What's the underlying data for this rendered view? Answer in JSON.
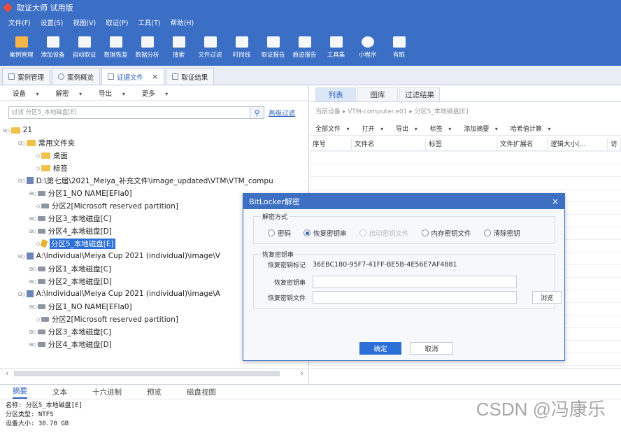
{
  "app": {
    "title": "取证大师 试用版"
  },
  "menu": [
    "文件(F)",
    "设置(S)",
    "视图(V)",
    "取证(P)",
    "工具(T)",
    "帮助(H)"
  ],
  "toolbar": [
    {
      "label": "案例管理",
      "icon": "case-manage-icon"
    },
    {
      "label": "添加设备",
      "icon": "add-device-icon"
    },
    {
      "label": "自动取证",
      "icon": "auto-forensics-icon"
    },
    {
      "label": "数据恢复",
      "icon": "data-recovery-icon"
    },
    {
      "label": "数据分析",
      "icon": "data-analysis-icon"
    },
    {
      "label": "搜索",
      "icon": "search-icon"
    },
    {
      "label": "文件过滤",
      "icon": "file-filter-icon"
    },
    {
      "label": "时间线",
      "icon": "timeline-icon"
    },
    {
      "label": "取证报告",
      "icon": "report-icon"
    },
    {
      "label": "痕迹报告",
      "icon": "trace-report-icon"
    },
    {
      "label": "工具集",
      "icon": "toolset-icon"
    },
    {
      "label": "小程序",
      "icon": "mini-program-icon"
    },
    {
      "label": "有眼",
      "icon": "assistant-icon"
    }
  ],
  "doctabs": [
    {
      "label": "案例管理",
      "active": false
    },
    {
      "label": "案例概览",
      "active": false
    },
    {
      "label": "证据文件",
      "active": true,
      "close": "×"
    },
    {
      "label": "取证结果",
      "active": false
    }
  ],
  "left": {
    "toolbar": [
      "设备",
      "解密",
      "导出",
      "更多"
    ],
    "filter_placeholder": "过滤 分区5_本地磁盘[E]",
    "advanced": "高级过滤",
    "tree": [
      {
        "label": "21",
        "icon": "folder",
        "ex": "⊟○"
      },
      {
        "label": "常用文件夹",
        "icon": "folder",
        "ex": "⊟○"
      },
      {
        "label": "桌面",
        "icon": "folder",
        "ex": "○"
      },
      {
        "label": "标签",
        "icon": "folder",
        "ex": "○"
      },
      {
        "label": "D:\\第七届\\2021_Meiya_补充文件\\image_updated\\VTM\\VTM_compu",
        "icon": "image",
        "ex": "⊟○"
      },
      {
        "label": "分区1_NO NAME[EFla0]",
        "icon": "disk",
        "ex": "⊞○"
      },
      {
        "label": "分区2[Microsoft reserved partition]",
        "icon": "disk",
        "ex": "○"
      },
      {
        "label": "分区3_本地磁盘[C]",
        "icon": "disk",
        "ex": "⊞○"
      },
      {
        "label": "分区4_本地磁盘[D]",
        "icon": "disk",
        "ex": "⊞○"
      },
      {
        "label": "分区5_本地磁盘[E]",
        "icon": "key",
        "ex": "○",
        "selected": true
      },
      {
        "label": "A:\\Individual\\Meiya Cup 2021 (individual)\\image\\V",
        "icon": "image",
        "ex": "⊟○"
      },
      {
        "label": "分区1_本地磁盘[C]",
        "icon": "disk",
        "ex": "⊞○"
      },
      {
        "label": "分区2_本地磁盘[D]",
        "icon": "disk",
        "ex": "⊞○"
      },
      {
        "label": "A:\\Individual\\Meiya Cup 2021 (individual)\\image\\A",
        "icon": "image",
        "ex": "⊟○"
      },
      {
        "label": "分区1_NO NAME[EFla0]",
        "icon": "disk",
        "ex": "⊞○"
      },
      {
        "label": "分区2[Microsoft reserved partition]",
        "icon": "disk",
        "ex": "○"
      },
      {
        "label": "分区3_本地磁盘[C]",
        "icon": "disk",
        "ex": "⊞○"
      },
      {
        "label": "分区4_本地磁盘[D]",
        "icon": "disk",
        "ex": "⊞○"
      }
    ]
  },
  "right": {
    "tabs": [
      "列表",
      "图库",
      "过滤结果"
    ],
    "breadcrumb": "当前设备 ▸ VTM-computer.e01 ▸ 分区5_本地磁盘[E]",
    "filters": [
      "全部文件",
      "打开",
      "导出",
      "标签",
      "添加摘要",
      "哈希值计算"
    ],
    "columns": [
      "序号",
      "文件名",
      "标签",
      "文件扩展名",
      "逻辑大小(...",
      "访"
    ]
  },
  "dialog": {
    "title": "BitLocker解密",
    "close": "×",
    "method_label": "解密方式",
    "methods": [
      {
        "label": "密码",
        "checked": false,
        "disabled": false
      },
      {
        "label": "恢复密钥串",
        "checked": true,
        "disabled": false
      },
      {
        "label": "启动密钥文件",
        "checked": false,
        "disabled": true
      },
      {
        "label": "内存密钥文件",
        "checked": false,
        "disabled": false
      },
      {
        "label": "清除密钥",
        "checked": false,
        "disabled": false
      }
    ],
    "group_label": "恢复密钥串",
    "key_id_label": "恢复密钥标记",
    "key_id_value": "36EBC180-95F7-41FF-BE5B-4E56E7AF4881",
    "key_label": "恢复密钥串",
    "key_file_label": "恢复密钥文件",
    "browse": "浏览",
    "ok": "确定",
    "cancel": "取消"
  },
  "bottom": {
    "tabs": [
      "摘要",
      "文本",
      "十六进制",
      "预览",
      "磁盘视图"
    ],
    "info": [
      "名称: 分区5_本地磁盘[E]",
      "分区类型: NTFS",
      "设备大小: 30.70 GB"
    ]
  },
  "watermark": "CSDN @冯康乐"
}
